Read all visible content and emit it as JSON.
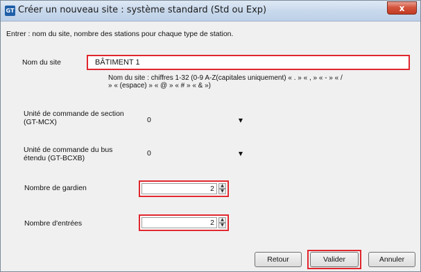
{
  "window": {
    "app_icon_text": "GT",
    "title": "Créer un nouveau site : système standard (Std ou Exp)",
    "close_symbol": "x"
  },
  "instruction": "Entrer : nom du site, nombre des stations pour chaque type de station.",
  "site_name": {
    "label": "Nom du site",
    "value": "BÂTIMENT 1",
    "hint_line1": "Nom du site : chiffres 1-32 (0-9 A-Z(capitales uniquement) « . » « , » « - » « /",
    "hint_line2": "» « (espace) » « @ » « # » « & »)"
  },
  "section_unit": {
    "label_line1": "Unité de commande de section",
    "label_line2": "(GT-MCX)",
    "value": "0",
    "arrow_icon": "chevron-down-icon"
  },
  "bus_unit": {
    "label_line1": "Unité de commande du bus",
    "label_line2": "étendu (GT-BCXB)",
    "value": "0",
    "arrow_icon": "chevron-down-icon"
  },
  "guards": {
    "label": "Nombre de gardien",
    "value": "2"
  },
  "entrances": {
    "label": "Nombre d'entrées",
    "value": "2"
  },
  "buttons": {
    "back": "Retour",
    "validate": "Valider",
    "cancel": "Annuler"
  },
  "colors": {
    "highlight": "#e0262d",
    "close_button": "#c23a22",
    "dialog_background": "#f0f0f0"
  }
}
